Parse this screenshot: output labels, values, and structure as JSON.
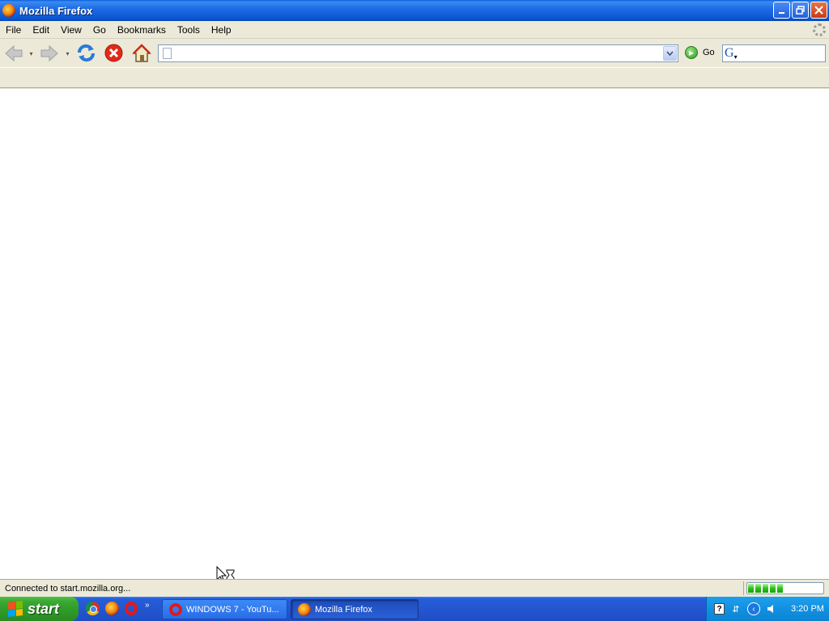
{
  "window": {
    "title": "Mozilla Firefox"
  },
  "menu": {
    "items": [
      "File",
      "Edit",
      "View",
      "Go",
      "Bookmarks",
      "Tools",
      "Help"
    ]
  },
  "toolbar": {
    "url_value": "",
    "go_label": "Go",
    "search_value": ""
  },
  "status": {
    "text": "Connected to start.mozilla.org...",
    "progress_percent": 50
  },
  "taskbar": {
    "start_label": "start",
    "tasks": [
      {
        "label": "WINDOWS 7 - YouTu...",
        "icon": "opera-icon"
      },
      {
        "label": "Mozilla Firefox",
        "icon": "firefox-icon"
      }
    ],
    "clock": "3:20 PM"
  },
  "colors": {
    "titlebar": "#0a56d0",
    "chrome": "#ece9d8",
    "taskbar": "#245edb",
    "start": "#3aa832",
    "tray": "#1290e0"
  }
}
